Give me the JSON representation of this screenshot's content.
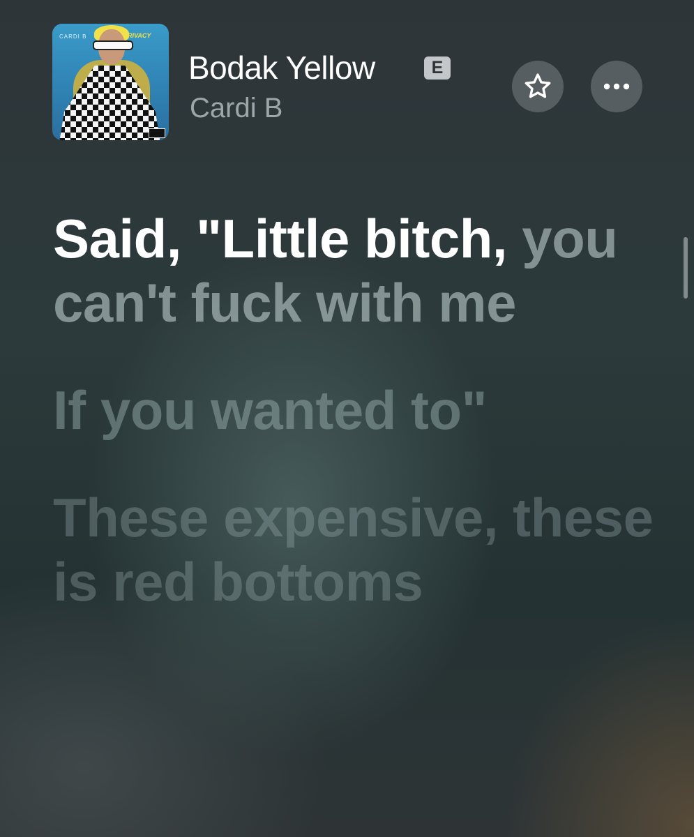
{
  "now_playing": {
    "title": "Bodak Yellow",
    "explicit_badge": "E",
    "artist": "Cardi B",
    "artwork": {
      "artist_text": "CARDI B",
      "album_text": "PRIVACY"
    }
  },
  "controls": {
    "favorite_icon": "star-icon",
    "more_icon": "ellipsis-icon"
  },
  "lyrics": {
    "current_line_sung": "Said, \"Little bitch,",
    "current_line_rest": "you can't fuck with me",
    "upcoming": [
      "If you wanted to\"",
      "These expensive, these is red bottoms"
    ]
  },
  "colors": {
    "background": "#2c3a3b",
    "active_lyric": "#ffffff",
    "explicit_badge": "#c3c7ca",
    "button_bg": "#6f777b"
  }
}
